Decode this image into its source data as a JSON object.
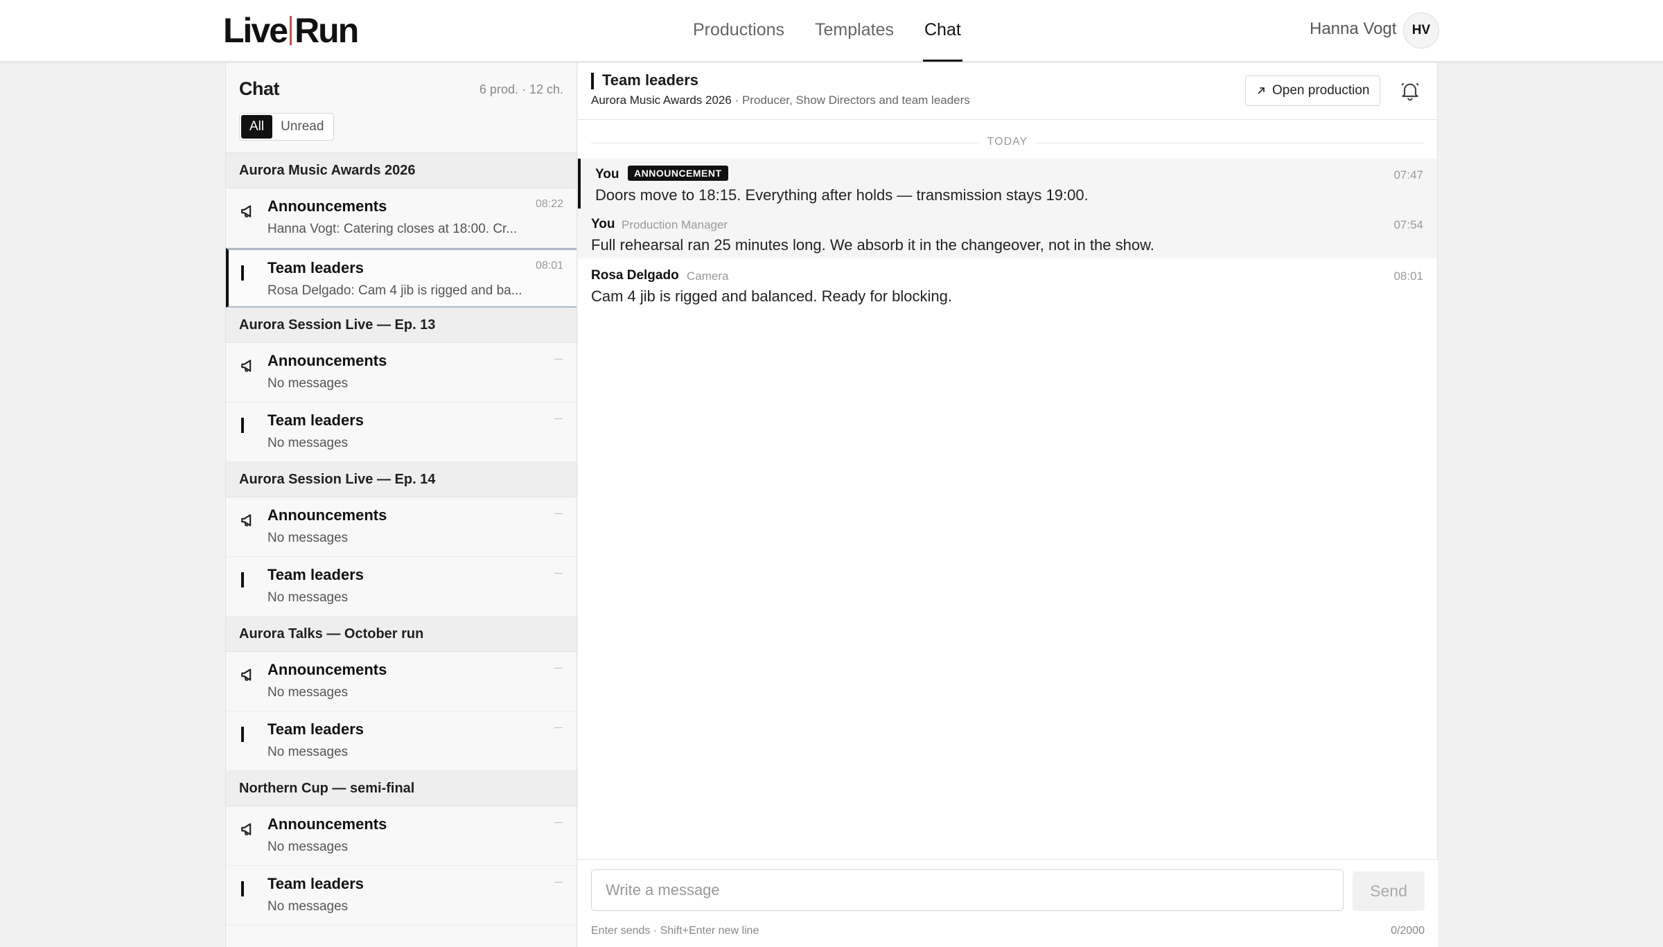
{
  "app": {
    "logo_left": "Live",
    "logo_right": "Run",
    "nav": [
      {
        "label": "Productions"
      },
      {
        "label": "Templates"
      },
      {
        "label": "Chat"
      }
    ],
    "user_name": "Hanna Vogt",
    "user_initials": "HV"
  },
  "sidebar": {
    "title": "Chat",
    "counts": "6 prod. · 12 ch.",
    "filters": [
      "All",
      "Unread"
    ],
    "groups": [
      {
        "name": "Aurora Music Awards 2026",
        "channels": [
          {
            "name": "Announcements",
            "preview": "Hanna Vogt: Catering closes at 18:00. Cr...",
            "time": "08:22"
          },
          {
            "name": "Team leaders",
            "preview": "Rosa Delgado: Cam 4 jib is rigged and ba...",
            "time": "08:01"
          }
        ]
      },
      {
        "name": "Aurora Session Live — Ep. 13",
        "channels": [
          {
            "name": "Announcements",
            "preview": "No messages"
          },
          {
            "name": "Team leaders",
            "preview": "No messages"
          }
        ]
      },
      {
        "name": "Aurora Session Live — Ep. 14",
        "channels": [
          {
            "name": "Announcements",
            "preview": "No messages"
          },
          {
            "name": "Team leaders",
            "preview": "No messages"
          }
        ]
      },
      {
        "name": "Aurora Talks — October run",
        "channels": [
          {
            "name": "Announcements",
            "preview": "No messages"
          },
          {
            "name": "Team leaders",
            "preview": "No messages"
          }
        ]
      },
      {
        "name": "Northern Cup — semi-final",
        "channels": [
          {
            "name": "Announcements",
            "preview": "No messages"
          },
          {
            "name": "Team leaders",
            "preview": "No messages"
          }
        ]
      }
    ]
  },
  "channel": {
    "title": "Team leaders",
    "production": "Aurora Music Awards 2026",
    "audience": " · Producer, Show Directors and team leaders",
    "open_label": "Open production",
    "day_label": "TODAY"
  },
  "messages": [
    {
      "author": "You",
      "badge": "ANNOUNCEMENT",
      "time": "07:47",
      "text": "Doors move to 18:15. Everything after holds — transmission stays 19:00."
    },
    {
      "author": "You",
      "role": "Production Manager",
      "time": "07:54",
      "text": "Full rehearsal ran 25 minutes long. We absorb it in the changeover, not in the show."
    },
    {
      "author": "Rosa Delgado",
      "role": "Camera",
      "time": "08:01",
      "text": "Cam 4 jib is rigged and balanced. Ready for blocking."
    }
  ],
  "composer": {
    "placeholder": "Write a message",
    "send_label": "Send",
    "hint": "Enter sends · Shift+Enter new line",
    "count": "0/2000"
  },
  "colors": {
    "accent": "#111111",
    "logo_separator": "#e0483a",
    "selection_border": "#aab9cc"
  }
}
